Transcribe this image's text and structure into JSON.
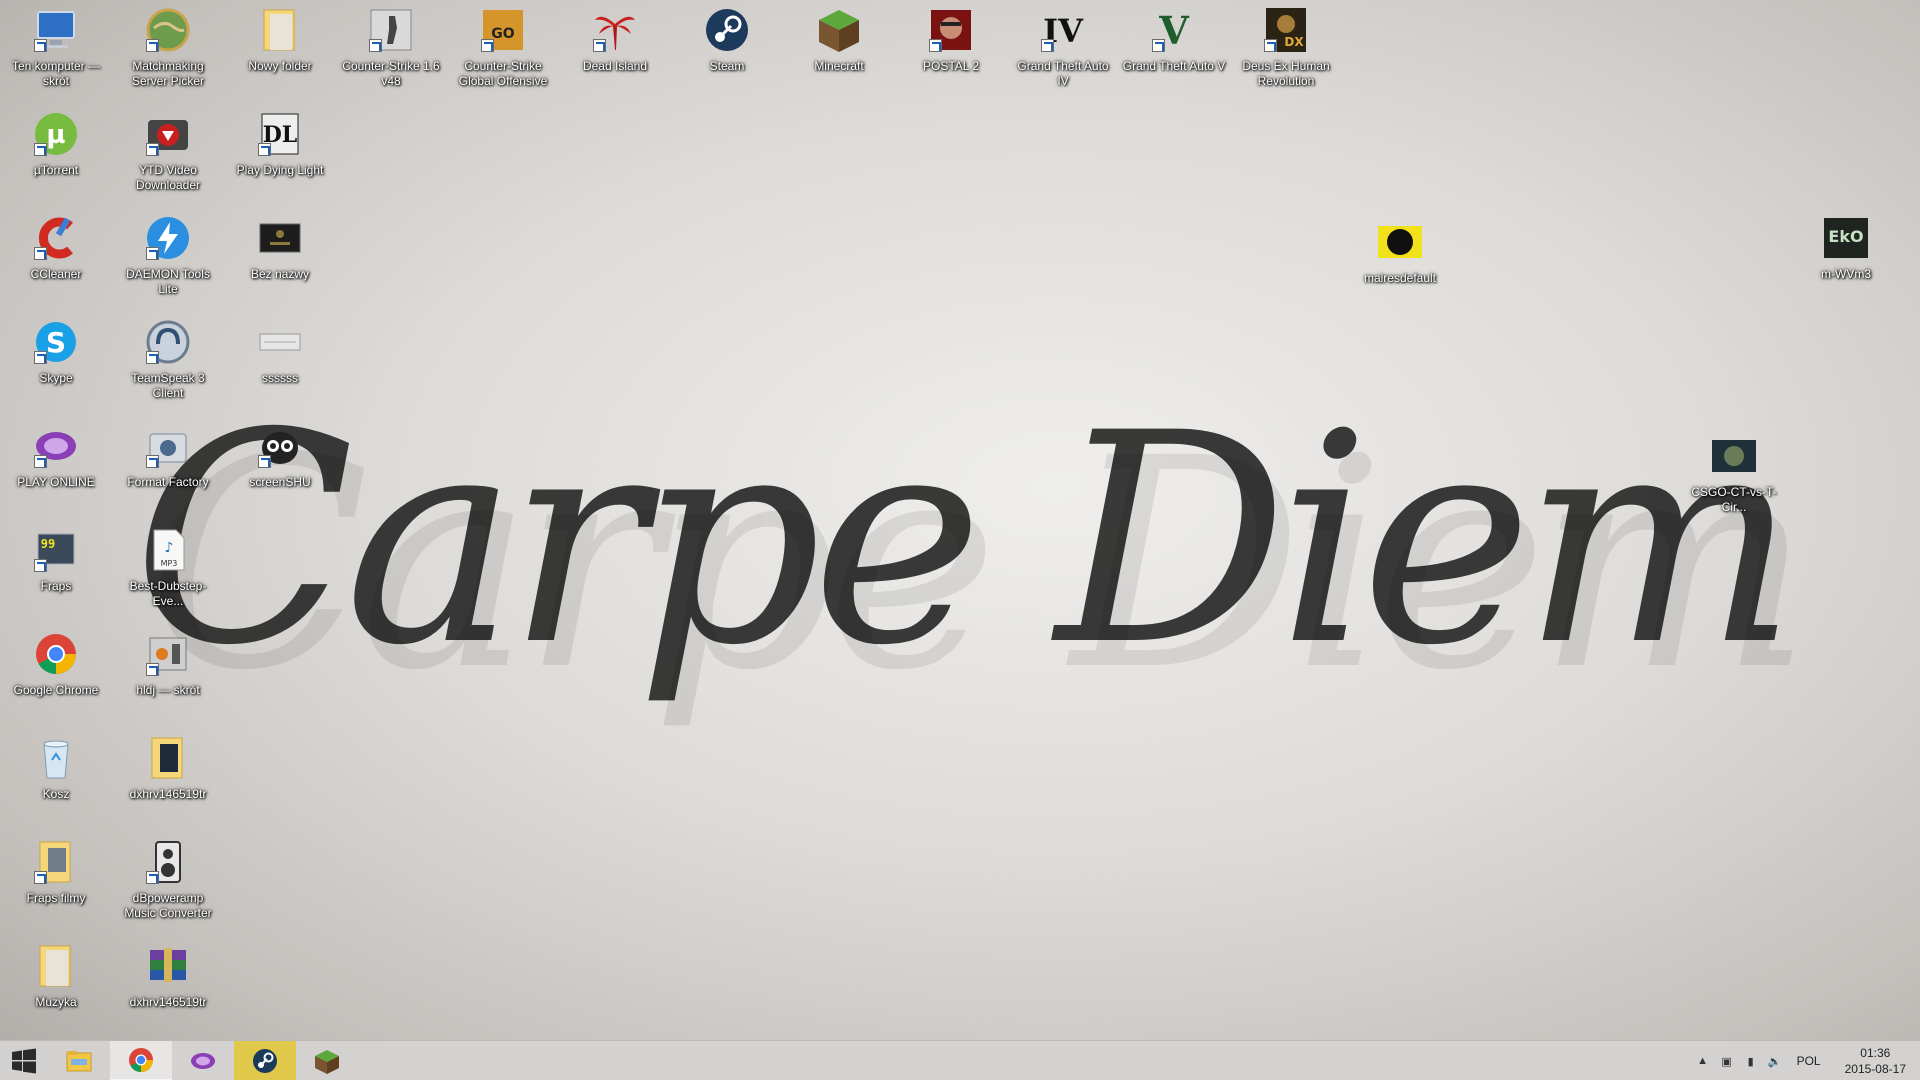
{
  "desktop": {
    "icons": [
      {
        "label": "Ten komputer — skrót",
        "icon": "computer-icon"
      },
      {
        "label": "Matchmaking Server Picker",
        "icon": "globe-icon"
      },
      {
        "label": "Nowy folder",
        "icon": "folder-icon"
      },
      {
        "label": "Counter-Strike 1.6 v48",
        "icon": "counter-strike-icon"
      },
      {
        "label": "Counter-Strike Global Offensive",
        "icon": "csgo-icon"
      },
      {
        "label": "Dead Island",
        "icon": "dead-island-icon"
      },
      {
        "label": "Steam",
        "icon": "steam-icon"
      },
      {
        "label": "Minecraft",
        "icon": "minecraft-icon"
      },
      {
        "label": "POSTAL 2",
        "icon": "postal-icon"
      },
      {
        "label": "Grand Theft Auto IV",
        "icon": "gta-iv-icon"
      },
      {
        "label": "Grand Theft Auto V",
        "icon": "gta-v-icon"
      },
      {
        "label": "Deus Ex Human Revolution",
        "icon": "deus-ex-icon"
      },
      {
        "label": "µTorrent",
        "icon": "utorrent-icon"
      },
      {
        "label": "YTD Video Downloader",
        "icon": "ytd-icon"
      },
      {
        "label": "Play Dying Light",
        "icon": "dying-light-icon"
      },
      {
        "label": "CCleaner",
        "icon": "ccleaner-icon"
      },
      {
        "label": "DAEMON Tools Lite",
        "icon": "daemon-tools-icon"
      },
      {
        "label": "Bez nazwy",
        "icon": "image-icon"
      },
      {
        "label": "Skype",
        "icon": "skype-icon"
      },
      {
        "label": "TeamSpeak 3 Client",
        "icon": "teamspeak-icon"
      },
      {
        "label": "ssssss",
        "icon": "file-icon"
      },
      {
        "label": "PLAY ONLINE",
        "icon": "play-online-icon"
      },
      {
        "label": "Format Factory",
        "icon": "format-factory-icon"
      },
      {
        "label": "screenSHU",
        "icon": "lemur-icon"
      },
      {
        "label": "Fraps",
        "icon": "fraps-icon"
      },
      {
        "label": "Best-Dubstep-Eve...",
        "icon": "mp3-icon"
      },
      {
        "label": "Google Chrome",
        "icon": "chrome-icon"
      },
      {
        "label": "hldj — skrót",
        "icon": "hldj-icon"
      },
      {
        "label": "Kosz",
        "icon": "recycle-bin-icon"
      },
      {
        "label": "dxhrv146519tr",
        "icon": "folder-icon"
      },
      {
        "label": "Fraps filmy",
        "icon": "folder-icon"
      },
      {
        "label": "dBpoweramp Music Converter",
        "icon": "speaker-icon"
      },
      {
        "label": "Muzyka",
        "icon": "folder-icon"
      },
      {
        "label": "dxhrv146519tr",
        "icon": "winrar-icon"
      },
      {
        "label": "mairesdefault",
        "icon": "image-icon"
      },
      {
        "label": "m-WVm3",
        "icon": "eko-image-icon"
      },
      {
        "label": "CSGO-CT-vs-T-Cir...",
        "icon": "image-icon"
      }
    ]
  },
  "wallpaper": {
    "text": "Carpe Diem"
  },
  "taskbar": {
    "apps": [
      "start-icon",
      "file-explorer-icon",
      "chrome-icon",
      "play-online-icon",
      "steam-icon",
      "minecraft-icon"
    ],
    "tray": {
      "language": "POL",
      "time": "01:36",
      "date": "2015-08-17"
    }
  },
  "colors": {
    "taskbar": "#d6d4d2",
    "steam_active": "#e0c94a",
    "icon_label": "#ffffff"
  }
}
